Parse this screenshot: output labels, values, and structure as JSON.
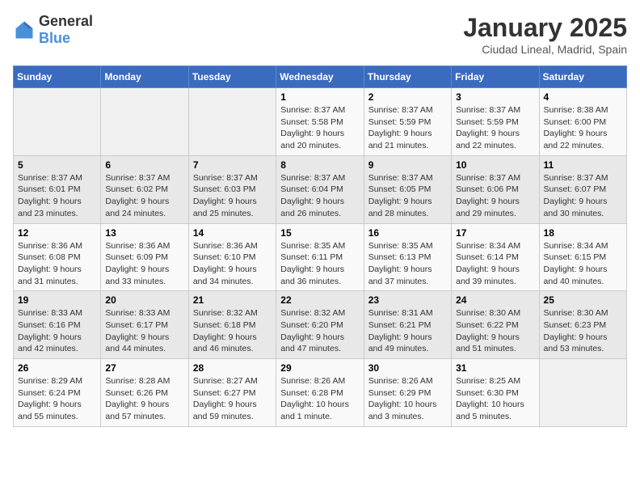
{
  "logo": {
    "text_general": "General",
    "text_blue": "Blue"
  },
  "calendar": {
    "title": "January 2025",
    "subtitle": "Ciudad Lineal, Madrid, Spain"
  },
  "weekdays": [
    "Sunday",
    "Monday",
    "Tuesday",
    "Wednesday",
    "Thursday",
    "Friday",
    "Saturday"
  ],
  "weeks": [
    [
      {
        "day": null,
        "info": null
      },
      {
        "day": null,
        "info": null
      },
      {
        "day": null,
        "info": null
      },
      {
        "day": "1",
        "info": "Sunrise: 8:37 AM\nSunset: 5:58 PM\nDaylight: 9 hours\nand 20 minutes."
      },
      {
        "day": "2",
        "info": "Sunrise: 8:37 AM\nSunset: 5:59 PM\nDaylight: 9 hours\nand 21 minutes."
      },
      {
        "day": "3",
        "info": "Sunrise: 8:37 AM\nSunset: 5:59 PM\nDaylight: 9 hours\nand 22 minutes."
      },
      {
        "day": "4",
        "info": "Sunrise: 8:38 AM\nSunset: 6:00 PM\nDaylight: 9 hours\nand 22 minutes."
      }
    ],
    [
      {
        "day": "5",
        "info": "Sunrise: 8:37 AM\nSunset: 6:01 PM\nDaylight: 9 hours\nand 23 minutes."
      },
      {
        "day": "6",
        "info": "Sunrise: 8:37 AM\nSunset: 6:02 PM\nDaylight: 9 hours\nand 24 minutes."
      },
      {
        "day": "7",
        "info": "Sunrise: 8:37 AM\nSunset: 6:03 PM\nDaylight: 9 hours\nand 25 minutes."
      },
      {
        "day": "8",
        "info": "Sunrise: 8:37 AM\nSunset: 6:04 PM\nDaylight: 9 hours\nand 26 minutes."
      },
      {
        "day": "9",
        "info": "Sunrise: 8:37 AM\nSunset: 6:05 PM\nDaylight: 9 hours\nand 28 minutes."
      },
      {
        "day": "10",
        "info": "Sunrise: 8:37 AM\nSunset: 6:06 PM\nDaylight: 9 hours\nand 29 minutes."
      },
      {
        "day": "11",
        "info": "Sunrise: 8:37 AM\nSunset: 6:07 PM\nDaylight: 9 hours\nand 30 minutes."
      }
    ],
    [
      {
        "day": "12",
        "info": "Sunrise: 8:36 AM\nSunset: 6:08 PM\nDaylight: 9 hours\nand 31 minutes."
      },
      {
        "day": "13",
        "info": "Sunrise: 8:36 AM\nSunset: 6:09 PM\nDaylight: 9 hours\nand 33 minutes."
      },
      {
        "day": "14",
        "info": "Sunrise: 8:36 AM\nSunset: 6:10 PM\nDaylight: 9 hours\nand 34 minutes."
      },
      {
        "day": "15",
        "info": "Sunrise: 8:35 AM\nSunset: 6:11 PM\nDaylight: 9 hours\nand 36 minutes."
      },
      {
        "day": "16",
        "info": "Sunrise: 8:35 AM\nSunset: 6:13 PM\nDaylight: 9 hours\nand 37 minutes."
      },
      {
        "day": "17",
        "info": "Sunrise: 8:34 AM\nSunset: 6:14 PM\nDaylight: 9 hours\nand 39 minutes."
      },
      {
        "day": "18",
        "info": "Sunrise: 8:34 AM\nSunset: 6:15 PM\nDaylight: 9 hours\nand 40 minutes."
      }
    ],
    [
      {
        "day": "19",
        "info": "Sunrise: 8:33 AM\nSunset: 6:16 PM\nDaylight: 9 hours\nand 42 minutes."
      },
      {
        "day": "20",
        "info": "Sunrise: 8:33 AM\nSunset: 6:17 PM\nDaylight: 9 hours\nand 44 minutes."
      },
      {
        "day": "21",
        "info": "Sunrise: 8:32 AM\nSunset: 6:18 PM\nDaylight: 9 hours\nand 46 minutes."
      },
      {
        "day": "22",
        "info": "Sunrise: 8:32 AM\nSunset: 6:20 PM\nDaylight: 9 hours\nand 47 minutes."
      },
      {
        "day": "23",
        "info": "Sunrise: 8:31 AM\nSunset: 6:21 PM\nDaylight: 9 hours\nand 49 minutes."
      },
      {
        "day": "24",
        "info": "Sunrise: 8:30 AM\nSunset: 6:22 PM\nDaylight: 9 hours\nand 51 minutes."
      },
      {
        "day": "25",
        "info": "Sunrise: 8:30 AM\nSunset: 6:23 PM\nDaylight: 9 hours\nand 53 minutes."
      }
    ],
    [
      {
        "day": "26",
        "info": "Sunrise: 8:29 AM\nSunset: 6:24 PM\nDaylight: 9 hours\nand 55 minutes."
      },
      {
        "day": "27",
        "info": "Sunrise: 8:28 AM\nSunset: 6:26 PM\nDaylight: 9 hours\nand 57 minutes."
      },
      {
        "day": "28",
        "info": "Sunrise: 8:27 AM\nSunset: 6:27 PM\nDaylight: 9 hours\nand 59 minutes."
      },
      {
        "day": "29",
        "info": "Sunrise: 8:26 AM\nSunset: 6:28 PM\nDaylight: 10 hours\nand 1 minute."
      },
      {
        "day": "30",
        "info": "Sunrise: 8:26 AM\nSunset: 6:29 PM\nDaylight: 10 hours\nand 3 minutes."
      },
      {
        "day": "31",
        "info": "Sunrise: 8:25 AM\nSunset: 6:30 PM\nDaylight: 10 hours\nand 5 minutes."
      },
      {
        "day": null,
        "info": null
      }
    ]
  ]
}
